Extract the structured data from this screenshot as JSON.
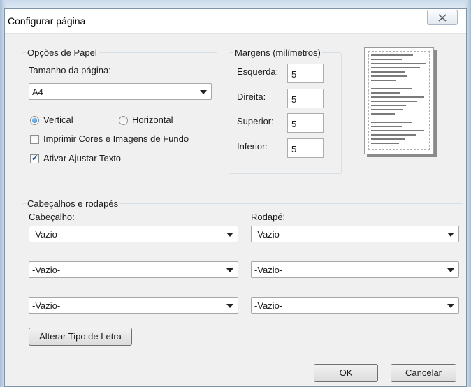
{
  "dialog": {
    "title": "Configurar página"
  },
  "paper_options": {
    "legend": "Opções de Papel",
    "page_size_label": "Tamanho da página:",
    "page_size_value": "A4",
    "orientation_vertical": "Vertical",
    "orientation_horizontal": "Horizontal",
    "orientation_selected": "Vertical",
    "print_backgrounds_label": "Imprimir Cores e Imagens de Fundo",
    "print_backgrounds_checked": false,
    "shrink_to_fit_label": "Ativar Ajustar Texto",
    "shrink_to_fit_checked": true
  },
  "margins": {
    "legend": "Margens (milímetros)",
    "left_label": "Esquerda:",
    "left_value": "5",
    "right_label": "Direita:",
    "right_value": "5",
    "top_label": "Superior:",
    "top_value": "5",
    "bottom_label": "Inferior:",
    "bottom_value": "5"
  },
  "headers_footers": {
    "legend": "Cabeçalhos e rodapés",
    "header_label": "Cabeçalho:",
    "footer_label": "Rodapé:",
    "header_values": [
      "-Vazio-",
      "-Vazio-",
      "-Vazio-"
    ],
    "footer_values": [
      "-Vazio-",
      "-Vazio-",
      "-Vazio-"
    ],
    "change_font_label": "Alterar Tipo de Letra"
  },
  "buttons": {
    "ok": "OK",
    "cancel": "Cancelar"
  },
  "icons": {
    "close": "close-icon",
    "dropdown": "chevron-down-icon",
    "preview": "page-preview-icon"
  }
}
